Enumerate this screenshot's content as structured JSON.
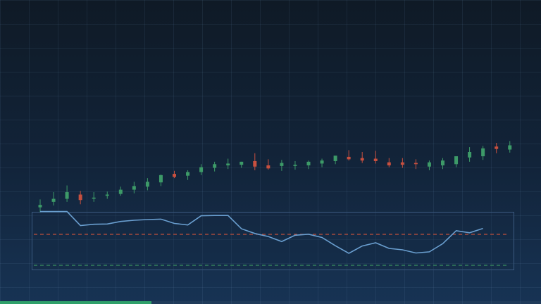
{
  "colors": {
    "up": "#3d9a68",
    "down": "#c8503f",
    "line": "#6a9fd0",
    "upper_threshold": "#c0503c",
    "lower_threshold": "#3a9060",
    "panel_border": "#3b5a80",
    "progress": "#2fa06a"
  },
  "progress": {
    "fraction": 0.28
  },
  "chart_data": [
    {
      "type": "candlestick",
      "title": "",
      "xlabel": "",
      "ylabel": "",
      "ylim": [
        50,
        100
      ],
      "grid": true,
      "x": [
        1,
        2,
        3,
        4,
        5,
        6,
        7,
        8,
        9,
        10,
        11,
        12,
        13,
        14,
        15,
        16,
        17,
        18,
        19,
        20,
        21,
        22,
        23,
        24,
        25,
        26,
        27,
        28,
        29,
        30,
        31,
        32,
        33,
        34,
        35,
        36
      ],
      "series": [
        {
          "open": [
            65.9,
            66.8,
            67.3,
            68.0,
            67.4,
            67.8,
            68.1,
            68.8,
            69.3,
            70.0,
            71.4,
            71.1,
            71.7,
            72.4,
            72.8,
            72.9,
            73.5,
            72.8,
            72.7,
            72.7,
            72.8,
            73.1,
            73.5,
            74.2,
            74.0,
            73.9,
            73.3,
            73.3,
            73.2,
            72.6,
            72.8,
            73.0,
            74.1,
            74.3,
            75.9,
            75.4
          ],
          "high": [
            67.2,
            68.4,
            69.5,
            68.6,
            68.4,
            68.5,
            69.3,
            70.1,
            70.7,
            71.3,
            71.9,
            72.0,
            73.0,
            73.4,
            73.9,
            73.4,
            74.8,
            73.8,
            73.7,
            73.5,
            73.6,
            73.9,
            74.1,
            75.3,
            75.0,
            75.2,
            74.0,
            74.0,
            73.8,
            73.6,
            74.0,
            74.3,
            75.8,
            76.0,
            76.5,
            76.8
          ],
          "low": [
            65.0,
            66.2,
            66.8,
            66.4,
            66.8,
            67.3,
            67.8,
            68.2,
            68.7,
            69.4,
            70.7,
            70.4,
            71.2,
            71.8,
            72.2,
            72.4,
            72.0,
            72.1,
            71.9,
            72.1,
            72.2,
            72.5,
            73.0,
            73.6,
            73.2,
            73.1,
            72.5,
            72.4,
            72.2,
            72.0,
            72.2,
            72.5,
            73.4,
            73.7,
            74.8,
            74.9
          ],
          "close": [
            66.3,
            67.3,
            68.4,
            67.1,
            67.5,
            68.0,
            68.8,
            69.4,
            70.1,
            71.2,
            70.9,
            71.7,
            72.5,
            73.0,
            73.1,
            73.4,
            72.6,
            72.3,
            73.2,
            72.9,
            73.4,
            73.6,
            74.4,
            73.8,
            73.6,
            73.5,
            72.8,
            72.9,
            73.0,
            73.3,
            73.6,
            74.3,
            75.0,
            75.6,
            75.5,
            76.1
          ]
        }
      ]
    },
    {
      "type": "line",
      "title": "",
      "xlabel": "",
      "ylabel": "",
      "ylim": [
        0,
        100
      ],
      "grid": true,
      "x": [
        1,
        2,
        3,
        4,
        5,
        6,
        7,
        8,
        9,
        10,
        11,
        12,
        13,
        14,
        15,
        16,
        17,
        18,
        19,
        20,
        21,
        22,
        23,
        24,
        25,
        26,
        27,
        28,
        29,
        30,
        31,
        32,
        33,
        34,
        35,
        36
      ],
      "series": [
        {
          "values": [
            99.5,
            99.5,
            99.5,
            81.3,
            83.0,
            83.4,
            86.6,
            88.2,
            89.1,
            89.6,
            84.1,
            82.1,
            94.0,
            94.4,
            94.4,
            77.2,
            71.1,
            67.2,
            60.7,
            68.8,
            70.2,
            65.9,
            55.3,
            45.5,
            54.9,
            59.1,
            51.8,
            50.0,
            45.9,
            47.4,
            57.9,
            74.7,
            72.0,
            77.6,
            null,
            null
          ]
        }
      ],
      "reference_lines": [
        {
          "y": 70,
          "style": "dashed",
          "color_key": "upper_threshold"
        },
        {
          "y": 30,
          "style": "dashed",
          "color_key": "lower_threshold"
        }
      ]
    }
  ]
}
